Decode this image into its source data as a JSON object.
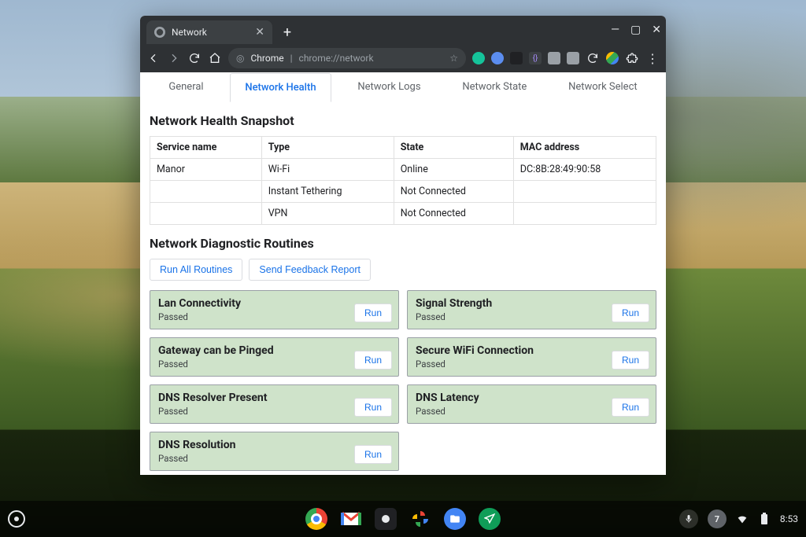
{
  "window": {
    "tab_title": "Network",
    "url_scheme_label": "Chrome",
    "url_path": "chrome://network",
    "minimize_glyph": "—",
    "maximize_glyph": "▢",
    "close_glyph": "✕",
    "newtab_glyph": "+",
    "tab_close_glyph": "✕",
    "star_glyph": "☆"
  },
  "extensions": [
    {
      "name": "grammarly",
      "color": "#15c39a"
    },
    {
      "name": "ext-blue",
      "color": "#5b8def"
    },
    {
      "name": "ext-dark",
      "color": "#202124"
    },
    {
      "name": "ext-braces",
      "color": "#7a5cff"
    },
    {
      "name": "ext-grey1",
      "color": "#9aa0a6"
    },
    {
      "name": "ext-grey2",
      "color": "#9aa0a6"
    },
    {
      "name": "ext-reload",
      "color": "#5f6368"
    },
    {
      "name": "drive",
      "color": "#fbbc04"
    }
  ],
  "page_tabs": {
    "general": "General",
    "health": "Network Health",
    "logs": "Network Logs",
    "state": "Network State",
    "select": "Network Select"
  },
  "snapshot": {
    "heading": "Network Health Snapshot",
    "columns": {
      "service": "Service name",
      "type": "Type",
      "state": "State",
      "mac": "MAC address"
    },
    "rows": [
      {
        "service": "Manor",
        "type": "Wi-Fi",
        "state": "Online",
        "mac": "DC:8B:28:49:90:58"
      },
      {
        "service": "",
        "type": "Instant Tethering",
        "state": "Not Connected",
        "mac": ""
      },
      {
        "service": "",
        "type": "VPN",
        "state": "Not Connected",
        "mac": ""
      }
    ]
  },
  "diagnostics": {
    "heading": "Network Diagnostic Routines",
    "run_all": "Run All Routines",
    "feedback": "Send Feedback Report",
    "run_label": "Run",
    "passed_label": "Passed",
    "cards": [
      {
        "title": "Lan Connectivity",
        "status": "Passed"
      },
      {
        "title": "Signal Strength",
        "status": "Passed"
      },
      {
        "title": "Gateway can be Pinged",
        "status": "Passed"
      },
      {
        "title": "Secure WiFi Connection",
        "status": "Passed"
      },
      {
        "title": "DNS Resolver Present",
        "status": "Passed"
      },
      {
        "title": "DNS Latency",
        "status": "Passed"
      },
      {
        "title": "DNS Resolution",
        "status": "Passed"
      }
    ]
  },
  "shelf": {
    "time": "8:53",
    "notif_count": "7",
    "apps": [
      "chrome",
      "gmail",
      "app-dark",
      "photos",
      "files",
      "messages"
    ]
  }
}
